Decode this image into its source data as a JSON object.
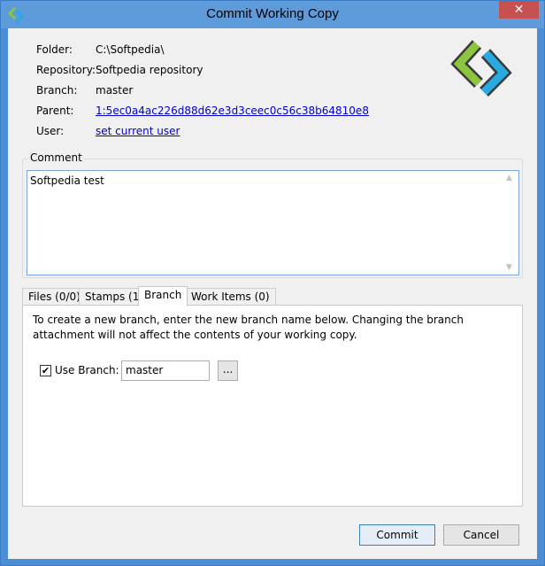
{
  "window": {
    "title": "Commit Working Copy",
    "close_glyph": "✕"
  },
  "info": {
    "folder_label": "Folder:",
    "folder_value": "C:\\Softpedia\\",
    "repository_label": "Repository:",
    "repository_value": "Softpedia repository",
    "branch_label": "Branch:",
    "branch_value": "master",
    "parent_label": "Parent:",
    "parent_value": "1:5ec0a4ac226d88d62e3d3ceec0c56c38b64810e8",
    "user_label": "User:",
    "user_value": "set current user"
  },
  "comment": {
    "legend": "Comment",
    "text": "Softpedia test"
  },
  "tabs": [
    {
      "label": "Files (0/0)",
      "active": false
    },
    {
      "label": "Stamps (1)",
      "active": false
    },
    {
      "label": "Branch",
      "active": true
    },
    {
      "label": "Work Items (0)",
      "active": false
    }
  ],
  "branch_tab": {
    "description": "To create a new branch, enter the new branch name below.  Changing the branch attachment will not affect the contents of your working copy.",
    "use_branch_label": "Use Branch:",
    "use_branch_checked": true,
    "branch_name": "master",
    "browse_label": "..."
  },
  "buttons": {
    "commit": "Commit",
    "cancel": "Cancel"
  },
  "colors": {
    "logo_green": "#8cc63f",
    "logo_blue": "#29abe2",
    "link": "#0000cc"
  },
  "icons": {
    "app": "app-logo-icon",
    "logo": "sync-arrows-logo",
    "scroll_up": "scroll-up-arrow-icon",
    "scroll_down": "scroll-down-arrow-icon",
    "check": "checkmark-icon"
  }
}
